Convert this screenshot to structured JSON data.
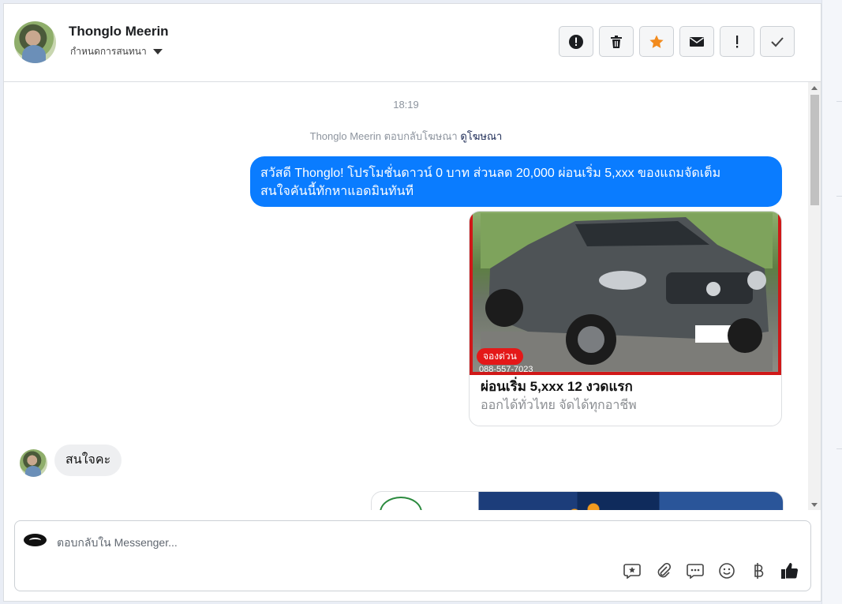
{
  "header": {
    "name": "Thonglo Meerin",
    "assign_label": "กำหนดการสนทนา",
    "actions": [
      "spam-icon",
      "trash-icon",
      "star-icon",
      "envelope-icon",
      "exclamation-icon",
      "check-icon"
    ],
    "star_color": "#f7b928"
  },
  "thread": {
    "time": "18:19",
    "reply_info": "Thonglo Meerin ตอบกลับโฆษณา",
    "view_ad": "ดูโฆษณา",
    "outgoing_line1": "สวัสดี Thonglo! โปรโมชั่นดาวน์ 0 บาท ส่วนลด 20,000 ผ่อนเริ่ม 5,xxx ของแถมจัดเต็ม",
    "outgoing_line2": "สนใจคันนี้ทักหาแอดมินทันที",
    "outgoing_color": "#0a7cff",
    "card": {
      "badge": "จองด่วน",
      "phone": "088-557-7023",
      "title": "ผ่อนเริ่ม 5,xxx 12 งวดแรก",
      "subtitle": "ออกได้ทั่วไทย จัดได้ทุกอาชีพ"
    },
    "incoming": "สนใจคะ"
  },
  "composer": {
    "placeholder": "ตอบกลับใน Messenger...",
    "tools": [
      "saved-reply-icon",
      "attach-icon",
      "comment-icon",
      "emoji-icon",
      "baht-icon",
      "like-icon"
    ]
  }
}
